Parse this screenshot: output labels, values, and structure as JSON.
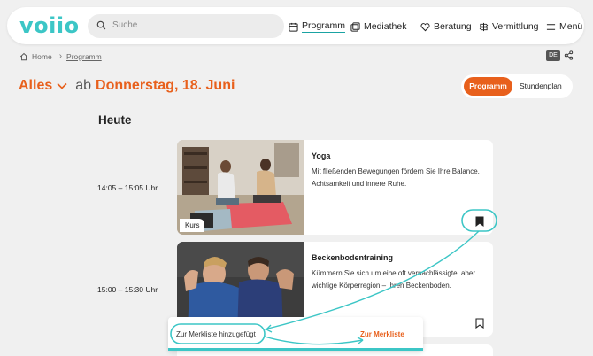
{
  "header": {
    "logo": "voiio",
    "search_placeholder": "Suche",
    "nav": [
      {
        "label": "Programm",
        "icon": "calendar-icon",
        "active": true
      },
      {
        "label": "Mediathek",
        "icon": "media-icon"
      },
      {
        "label": "Beratung",
        "icon": "heart-hands-icon"
      },
      {
        "label": "Vermittlung",
        "icon": "signpost-icon"
      },
      {
        "label": "Menü",
        "icon": "hamburger-icon"
      }
    ]
  },
  "breadcrumb": {
    "home": "Home",
    "current": "Programm"
  },
  "language": "DE",
  "filter": {
    "category": "Alles",
    "prefix": "ab",
    "date": "Donnerstag, 18. Juni"
  },
  "view_toggle": {
    "active": "Programm",
    "inactive": "Stundenplan"
  },
  "section_title": "Heute",
  "events": [
    {
      "time": "14:05 – 15:05 Uhr",
      "title": "Yoga",
      "description": "Mit fließenden Bewegungen fördern Sie Ihre Balance, Achtsamkeit und innere Ruhe.",
      "badge": "Kurs",
      "bookmarked": true
    },
    {
      "time": "15:00 – 15:30 Uhr",
      "title": "Beckenbodentraining",
      "description": "Kümmern Sie sich um eine oft vernachlässigte, aber wichtige Körperregion – Ihren Beckenboden.",
      "bookmarked": false
    }
  ],
  "toast": {
    "message": "Zur Merkliste hinzugefügt",
    "link": "Zur Merkliste"
  },
  "colors": {
    "brand": "#3cc6c6",
    "accent": "#e8601c",
    "background": "#f0f0f0"
  }
}
